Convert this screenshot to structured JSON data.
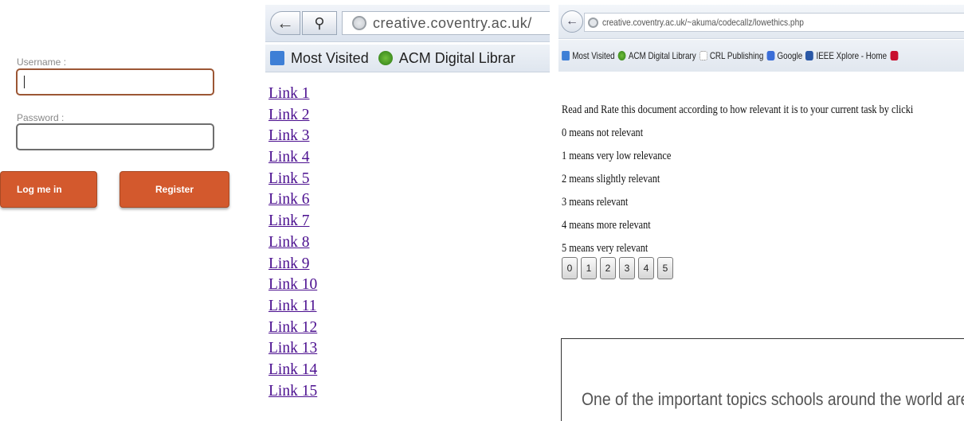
{
  "login": {
    "username_label": "Username :",
    "password_label": "Password :",
    "login_button": "Log me in",
    "register_button": "Register"
  },
  "links_browser": {
    "url_domain": "creative.coventry.ac.uk/",
    "bookmarks": [
      "Most Visited",
      "ACM Digital Librar"
    ],
    "links": [
      "Link 1",
      "Link 2",
      "Link 3",
      "Link 4",
      "Link 5",
      "Link 6",
      "Link 7",
      "Link 8",
      "Link 9",
      "Link 10",
      "Link 11",
      "Link 12",
      "Link 13",
      "Link 14",
      "Link 15"
    ]
  },
  "rating_browser": {
    "url": "creative.coventry.ac.uk/~akuma/codecallz/lowethics.php",
    "bookmarks": [
      "Most Visited",
      "ACM Digital Library",
      "CRL Publishing",
      "Google",
      "IEEE Xplore - Home"
    ],
    "instruction": "Read and Rate this document according to how relevant it is to your current task by clicki",
    "scale": [
      "0 means not relevant",
      "1 means very low relevance",
      "2 means slightly relevant",
      "3 means relevant",
      "4 means more relevant",
      "5 means very relevant"
    ],
    "rating_buttons": [
      "0",
      "1",
      "2",
      "3",
      "4",
      "5"
    ],
    "document_text": "One of the important topics schools around the world are"
  },
  "colors": {
    "button": "#d3592d",
    "link": "#4b0f8f"
  }
}
